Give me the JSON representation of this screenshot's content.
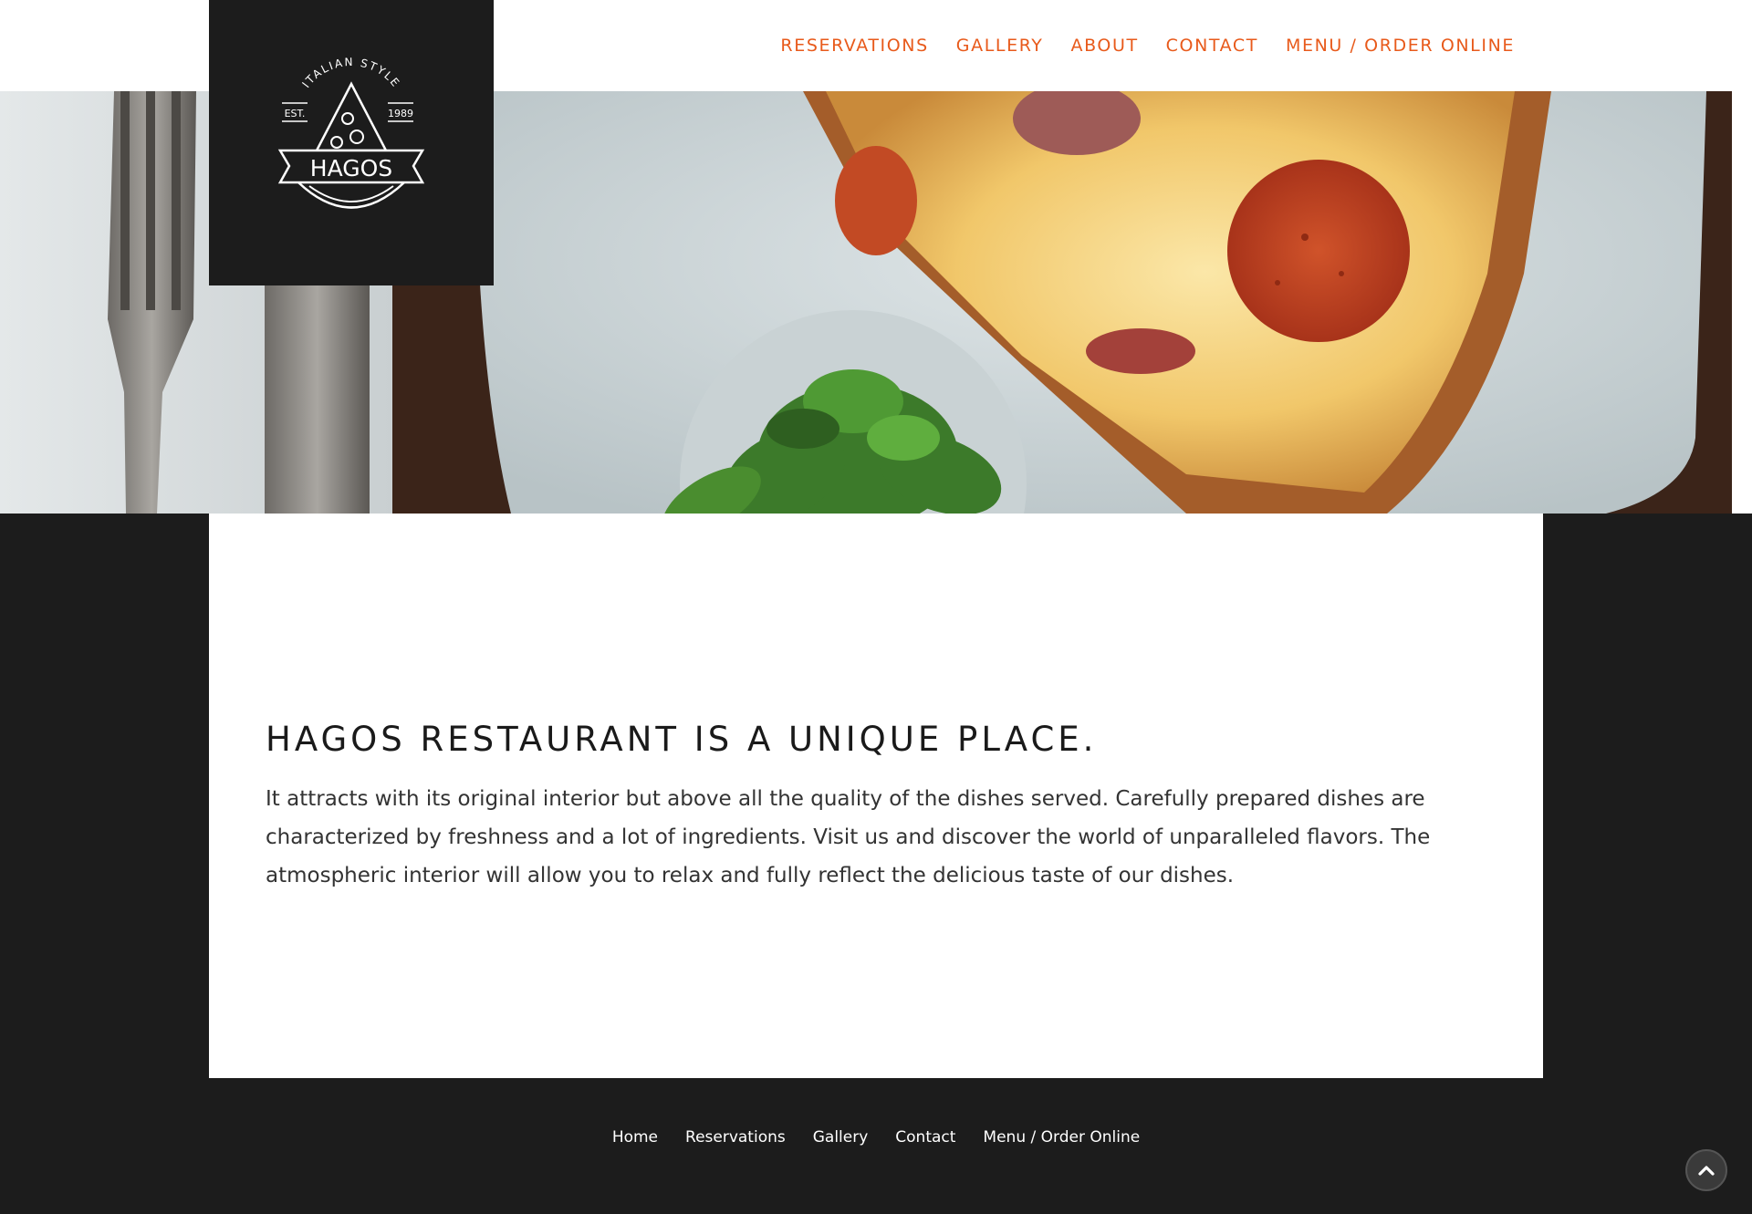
{
  "brand": {
    "logo_text": "HAGOS",
    "logo_arc_text": "ITALIAN STYLE",
    "logo_est": "EST.",
    "logo_year": "1989"
  },
  "nav": {
    "items": [
      {
        "label": "RESERVATIONS"
      },
      {
        "label": "GALLERY"
      },
      {
        "label": "ABOUT"
      },
      {
        "label": "CONTACT"
      },
      {
        "label": "MENU / ORDER ONLINE"
      }
    ]
  },
  "hero": {
    "image_icon": "pizza-photo"
  },
  "main": {
    "headline": "HAGOS RESTAURANT IS A UNIQUE PLACE.",
    "body": "It attracts with its original interior but above all the quality of the dishes served. Carefully prepared dishes are characterized by freshness and a lot of ingredients. Visit us and discover the world of unparalleled flavors. The atmospheric interior will allow you to relax and fully reflect the delicious taste of our dishes."
  },
  "footer": {
    "links": [
      {
        "label": "Home"
      },
      {
        "label": "Reservations"
      },
      {
        "label": "Gallery"
      },
      {
        "label": "Contact"
      },
      {
        "label": "Menu / Order Online"
      }
    ]
  },
  "scroll_top": {
    "icon": "chevron-up-icon"
  },
  "colors": {
    "accent": "#e85a1b",
    "dark": "#1c1c1c",
    "white": "#ffffff"
  }
}
